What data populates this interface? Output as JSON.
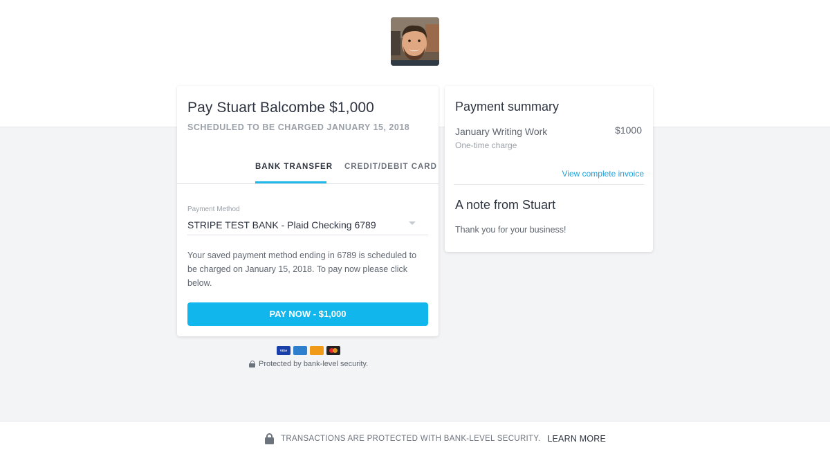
{
  "payee": {
    "avatar_icon": "user-photo"
  },
  "payment": {
    "title": "Pay Stuart Balcombe $1,000",
    "scheduled": "SCHEDULED TO BE CHARGED JANUARY 15, 2018",
    "tabs": [
      {
        "label": "BANK TRANSFER",
        "active": true
      },
      {
        "label": "CREDIT/DEBIT CARD",
        "active": false
      }
    ],
    "method_label": "Payment Method",
    "method_value": "STRIPE TEST BANK - Plaid Checking 6789",
    "notice": "Your saved payment method ending in 6789 is scheduled to be charged on January 15, 2018. To pay now please click below.",
    "pay_button": "PAY NOW - $1,000",
    "accent_color": "#11b6ec"
  },
  "card_logos": [
    "VISA",
    "AMERICAN EXPRESS",
    "DISCOVER",
    "mastercard"
  ],
  "security_note": "Protected by bank-level security.",
  "summary": {
    "title": "Payment summary",
    "item_name": "January Writing Work",
    "item_amount": "$1000",
    "item_type": "One-time charge",
    "invoice_link": "View complete invoice",
    "note_title": "A note from Stuart",
    "note_text": "Thank you for your business!"
  },
  "footer": {
    "text": "TRANSACTIONS ARE PROTECTED WITH BANK-LEVEL SECURITY.",
    "link": "LEARN MORE"
  }
}
